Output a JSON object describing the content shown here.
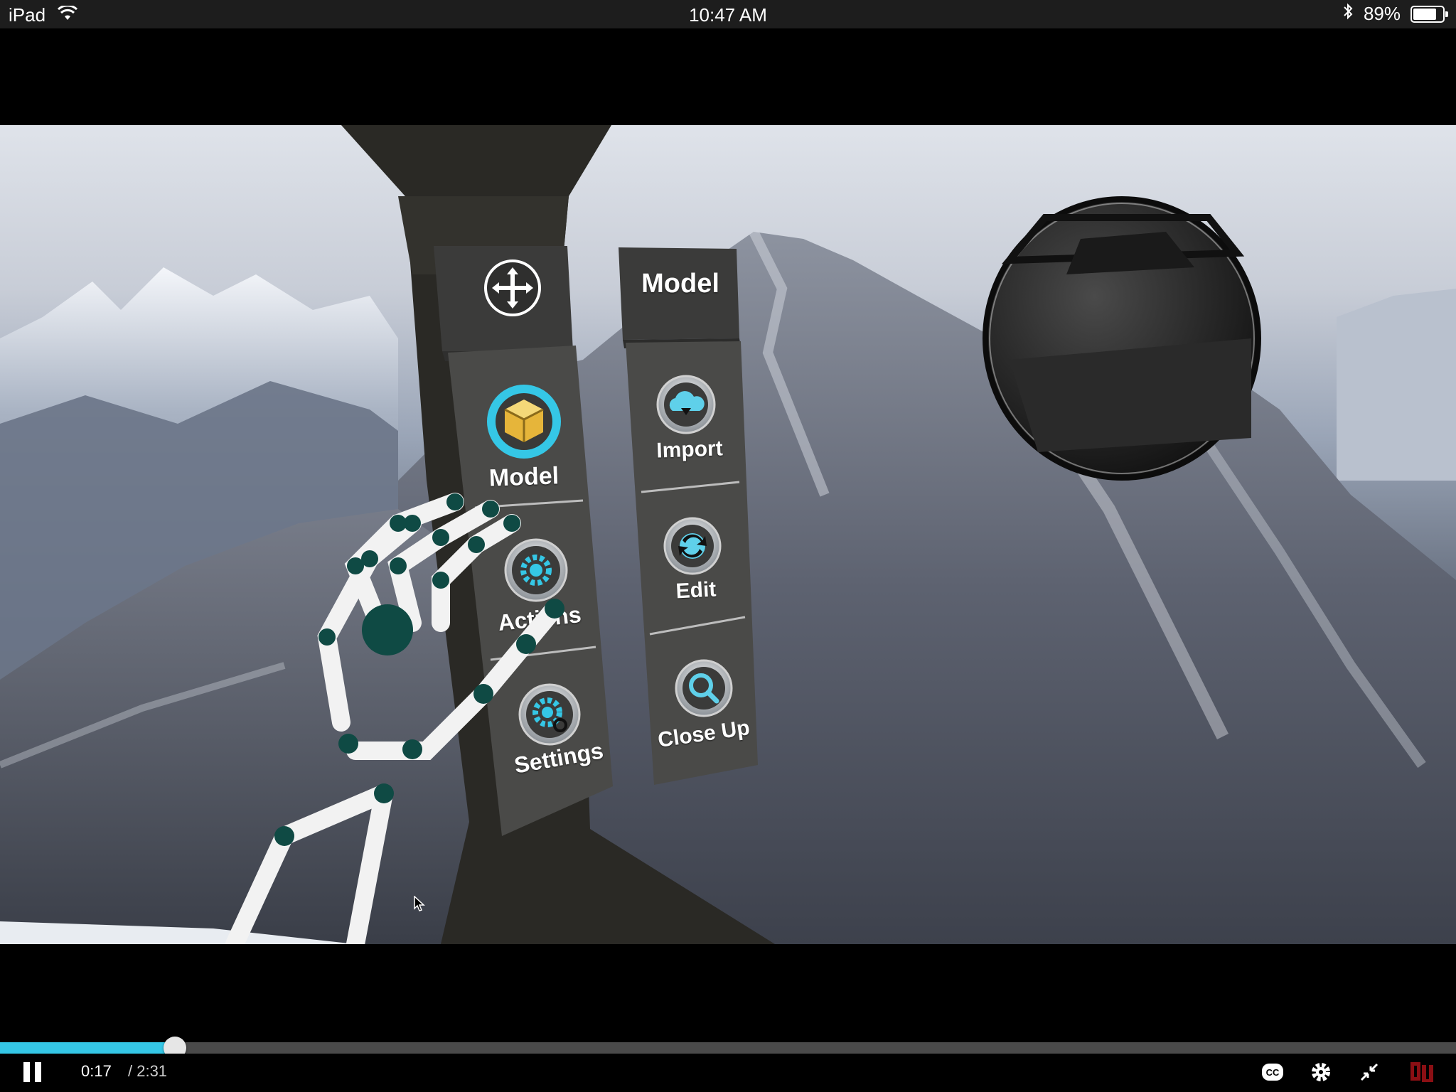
{
  "status_bar": {
    "device": "iPad",
    "time": "10:47 AM",
    "battery_percent": "89%",
    "battery_level": 0.89,
    "icons": [
      "wifi-icon",
      "bluetooth-icon",
      "battery-icon"
    ]
  },
  "video": {
    "scene_menu": {
      "left_panel_items": [
        "Model",
        "Actions",
        "Settings"
      ],
      "right_panel_title": "Model",
      "right_panel_items": [
        "Import",
        "Edit",
        "Close Up"
      ],
      "active_color": "#35c7e6"
    }
  },
  "player": {
    "current_time": "0:17",
    "duration": "/ 2:31",
    "progress": 0.12,
    "accent_color": "#35c7e6",
    "buttons": [
      "pause-icon",
      "closed-captions-icon",
      "settings-gear-icon",
      "exit-fullscreen-icon",
      "ou-logo"
    ]
  }
}
